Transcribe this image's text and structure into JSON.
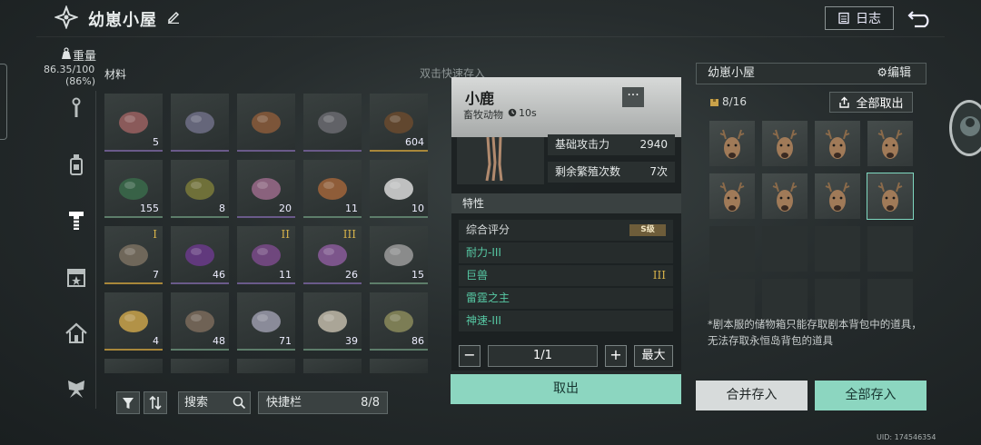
{
  "header": {
    "title": "幼崽小屋",
    "log_label": "日志"
  },
  "weight": {
    "label": "重量",
    "value": "86.35/100",
    "percent": "(86%)"
  },
  "inventory": {
    "category_label": "材料",
    "double_click_hint": "双击快速存入",
    "items": [
      {
        "count": "5",
        "tier": "",
        "frame": "purple"
      },
      {
        "count": "",
        "tier": "",
        "frame": "purple"
      },
      {
        "count": "",
        "tier": "",
        "frame": "purple"
      },
      {
        "count": "",
        "tier": "",
        "frame": "purple"
      },
      {
        "count": "604",
        "tier": "",
        "frame": "gold"
      },
      {
        "count": "155",
        "tier": "",
        "frame": "green"
      },
      {
        "count": "8",
        "tier": "",
        "frame": "green"
      },
      {
        "count": "20",
        "tier": "",
        "frame": "purple"
      },
      {
        "count": "11",
        "tier": "",
        "frame": "green"
      },
      {
        "count": "10",
        "tier": "",
        "frame": "green"
      },
      {
        "count": "7",
        "tier": "I",
        "frame": "gold"
      },
      {
        "count": "46",
        "tier": "",
        "frame": "purple"
      },
      {
        "count": "11",
        "tier": "II",
        "frame": "purple"
      },
      {
        "count": "26",
        "tier": "III",
        "frame": "purple"
      },
      {
        "count": "15",
        "tier": "",
        "frame": "green"
      },
      {
        "count": "4",
        "tier": "",
        "frame": "gold"
      },
      {
        "count": "48",
        "tier": "",
        "frame": "green"
      },
      {
        "count": "71",
        "tier": "",
        "frame": "green"
      },
      {
        "count": "39",
        "tier": "",
        "frame": "green"
      },
      {
        "count": "86",
        "tier": "",
        "frame": "green"
      }
    ],
    "search_label": "搜索",
    "quickbar_label": "快捷栏",
    "quickbar_count": "8/8"
  },
  "detail": {
    "name": "小鹿",
    "type": "畜牧动物",
    "time": "10s",
    "stats": [
      {
        "label": "基础攻击力",
        "value": "2940"
      },
      {
        "label": "剩余繁殖次数",
        "value": "7次"
      }
    ],
    "traits_header": "特性",
    "overall_label": "综合评分",
    "overall_rank": "S级",
    "traits": [
      {
        "name": "耐力-III",
        "tier": ""
      },
      {
        "name": "巨兽",
        "tier": "III"
      },
      {
        "name": "雷霆之主",
        "tier": ""
      },
      {
        "name": "神速-III",
        "tier": ""
      }
    ],
    "quantity": "1/1",
    "max_label": "最大",
    "take_label": "取出"
  },
  "storage": {
    "name": "幼崽小屋",
    "edit_label": "编辑",
    "capacity": "8/16",
    "take_all_label": "全部取出",
    "note": "*剧本服的储物箱只能存取剧本背包中的道具，无法存取永恒岛背包的道具",
    "merge_label": "合并存入",
    "store_all_label": "全部存入"
  },
  "uid": "UID: 174546354",
  "colors": {
    "accent": "#8cd6c0",
    "trait_green": "#57c9a4",
    "tier_gold": "#d6b24a"
  }
}
